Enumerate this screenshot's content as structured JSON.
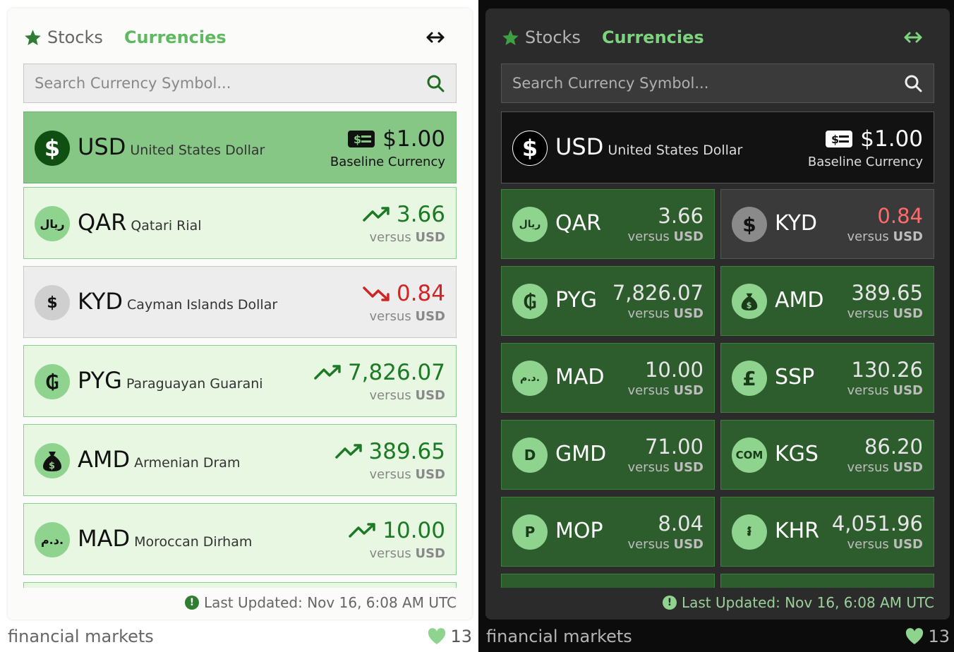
{
  "tabs": {
    "stocks": "Stocks",
    "currencies": "Currencies"
  },
  "search": {
    "placeholder": "Search Currency Symbol..."
  },
  "baseline": {
    "code": "USD",
    "name": "United States Dollar",
    "value": "$1.00",
    "label": "Baseline Currency"
  },
  "versus_prefix": "versus",
  "versus_code": "USD",
  "light_rows": [
    {
      "code": "QAR",
      "name": "Qatari Rial",
      "value": "3.66",
      "trend": "up",
      "icon": "ريال"
    },
    {
      "code": "KYD",
      "name": "Cayman Islands Dollar",
      "value": "0.84",
      "trend": "down",
      "icon": "$"
    },
    {
      "code": "PYG",
      "name": "Paraguayan Guarani",
      "value": "7,826.07",
      "trend": "up",
      "icon": "₲"
    },
    {
      "code": "AMD",
      "name": "Armenian Dram",
      "value": "389.65",
      "trend": "up",
      "icon": "money-bag"
    },
    {
      "code": "MAD",
      "name": "Moroccan Dirham",
      "value": "10.00",
      "trend": "up",
      "icon": "د.م."
    }
  ],
  "dark_tiles": [
    {
      "code": "QAR",
      "value": "3.66",
      "icon": "ريال",
      "trend": "up"
    },
    {
      "code": "KYD",
      "value": "0.84",
      "icon": "$",
      "trend": "down"
    },
    {
      "code": "PYG",
      "value": "7,826.07",
      "icon": "₲",
      "trend": "up"
    },
    {
      "code": "AMD",
      "value": "389.65",
      "icon": "money-bag",
      "trend": "up"
    },
    {
      "code": "MAD",
      "value": "10.00",
      "icon": "د.م.",
      "trend": "up"
    },
    {
      "code": "SSP",
      "value": "130.26",
      "icon": "£",
      "trend": "up"
    },
    {
      "code": "GMD",
      "value": "71.00",
      "icon": "D",
      "trend": "up"
    },
    {
      "code": "KGS",
      "value": "86.20",
      "icon": "COM",
      "trend": "up"
    },
    {
      "code": "MOP",
      "value": "8.04",
      "icon": "P",
      "trend": "up"
    },
    {
      "code": "KHR",
      "value": "4,051.96",
      "icon": "៛",
      "trend": "up"
    }
  ],
  "last_updated": "Last Updated: Nov 16, 6:08 AM UTC",
  "footer": {
    "title": "financial markets",
    "likes": "13"
  },
  "colors": {
    "accent": "#5fb95f",
    "up": "#1d7a24",
    "down": "#d12525",
    "baseline_bg": "#86c785"
  }
}
